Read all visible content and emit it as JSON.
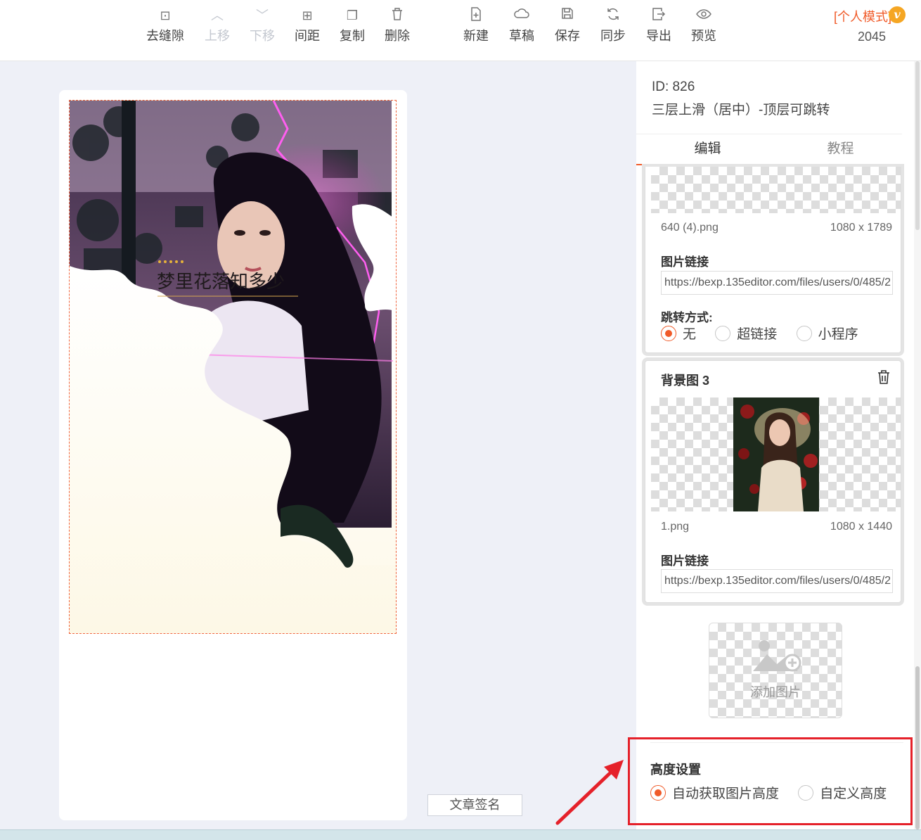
{
  "toolbar": {
    "items": [
      {
        "label": "去缝隙",
        "icon": "gap-icon",
        "glyph": "⊡",
        "disabled": false
      },
      {
        "label": "上移",
        "icon": "chevron-up-icon",
        "glyph": "︿",
        "disabled": true
      },
      {
        "label": "下移",
        "icon": "chevron-down-icon",
        "glyph": "﹀",
        "disabled": true
      },
      {
        "label": "间距",
        "icon": "spacing-icon",
        "glyph": "⊞",
        "disabled": false
      },
      {
        "label": "复制",
        "icon": "copy-icon",
        "glyph": "❐",
        "disabled": false
      },
      {
        "label": "删除",
        "icon": "trash-icon",
        "glyph": "🗑",
        "disabled": false
      },
      {
        "label": "新建",
        "icon": "new-file-icon",
        "glyph": "⊕",
        "disabled": false
      },
      {
        "label": "草稿",
        "icon": "cloud-icon",
        "glyph": "☁",
        "disabled": false
      },
      {
        "label": "保存",
        "icon": "save-icon",
        "glyph": "▣",
        "disabled": false
      },
      {
        "label": "同步",
        "icon": "sync-icon",
        "glyph": "↻",
        "disabled": false
      },
      {
        "label": "导出",
        "icon": "export-icon",
        "glyph": "⇥",
        "disabled": false
      },
      {
        "label": "预览",
        "icon": "eye-icon",
        "glyph": "◉",
        "disabled": false
      }
    ],
    "mode_label": "[个人模式]",
    "mode_badge": "v",
    "count": "2045"
  },
  "canvas": {
    "overlay_text": "梦里花落知多少",
    "sign_button": "文章签名"
  },
  "panel": {
    "id_label": "ID: 826",
    "template_name": "三层上滑（居中）-顶层可跳转",
    "tabs": [
      "编辑",
      "教程"
    ],
    "card1": {
      "file_name": "640 (4).png",
      "file_size": "1080 x 1789",
      "link_label": "图片链接",
      "link_value": "https://bexp.135editor.com/files/users/0/485/2",
      "jump_label": "跳转方式:",
      "jump_options": [
        "无",
        "超链接",
        "小程序"
      ],
      "jump_selected": "无"
    },
    "card2": {
      "title": "背景图 3",
      "file_name": "1.png",
      "file_size": "1080 x 1440",
      "link_label": "图片链接",
      "link_value": "https://bexp.135editor.com/files/users/0/485/2"
    },
    "add_image": "添加图片",
    "height": {
      "title": "高度设置",
      "options": [
        "自动获取图片高度",
        "自定义高度"
      ],
      "selected": "自动获取图片高度"
    }
  },
  "colors": {
    "accent": "#f05a28",
    "highlight": "#e5212a",
    "background": "#eef0f7"
  }
}
